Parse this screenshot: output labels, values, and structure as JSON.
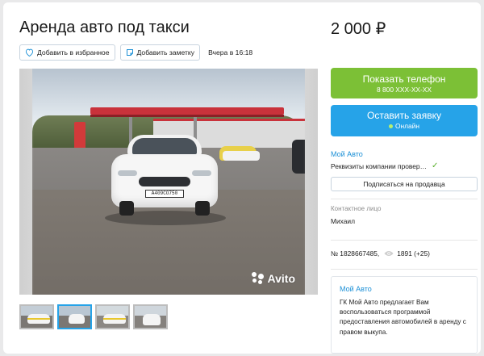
{
  "listing": {
    "title": "Аренда авто под такси",
    "price": "2 000 ₽",
    "favorite_label": "Добавить в избранное",
    "note_label": "Добавить заметку",
    "date": "Вчера в 16:18"
  },
  "photo": {
    "plate_text": "А409СО750",
    "watermark": "Avito",
    "thumbnails_count": 4,
    "active_thumbnail": 2
  },
  "actions": {
    "show_phone_label": "Показать телефон",
    "phone_masked": "8 800 XXX-XX-XX",
    "leave_request_label": "Оставить заявку",
    "online_label": "Онлайн"
  },
  "seller": {
    "name": "Мой Авто",
    "verification": "Реквизиты компании провер…",
    "subscribe_label": "Подписаться на продавца",
    "contact_label": "Контактное лицо",
    "contact_name": "Михаил"
  },
  "meta": {
    "listing_id": "№ 1828667485,",
    "views": "1891 (+25)"
  },
  "promo": {
    "heading": "Мой Авто",
    "text": "ГК Мой Авто предлагает Вам воспользоваться программой предоставления автомобилей в аренду с правом выкупа."
  },
  "colors": {
    "primary_green": "#7cc036",
    "primary_blue": "#26a3e8",
    "link": "#1a8fd6"
  }
}
